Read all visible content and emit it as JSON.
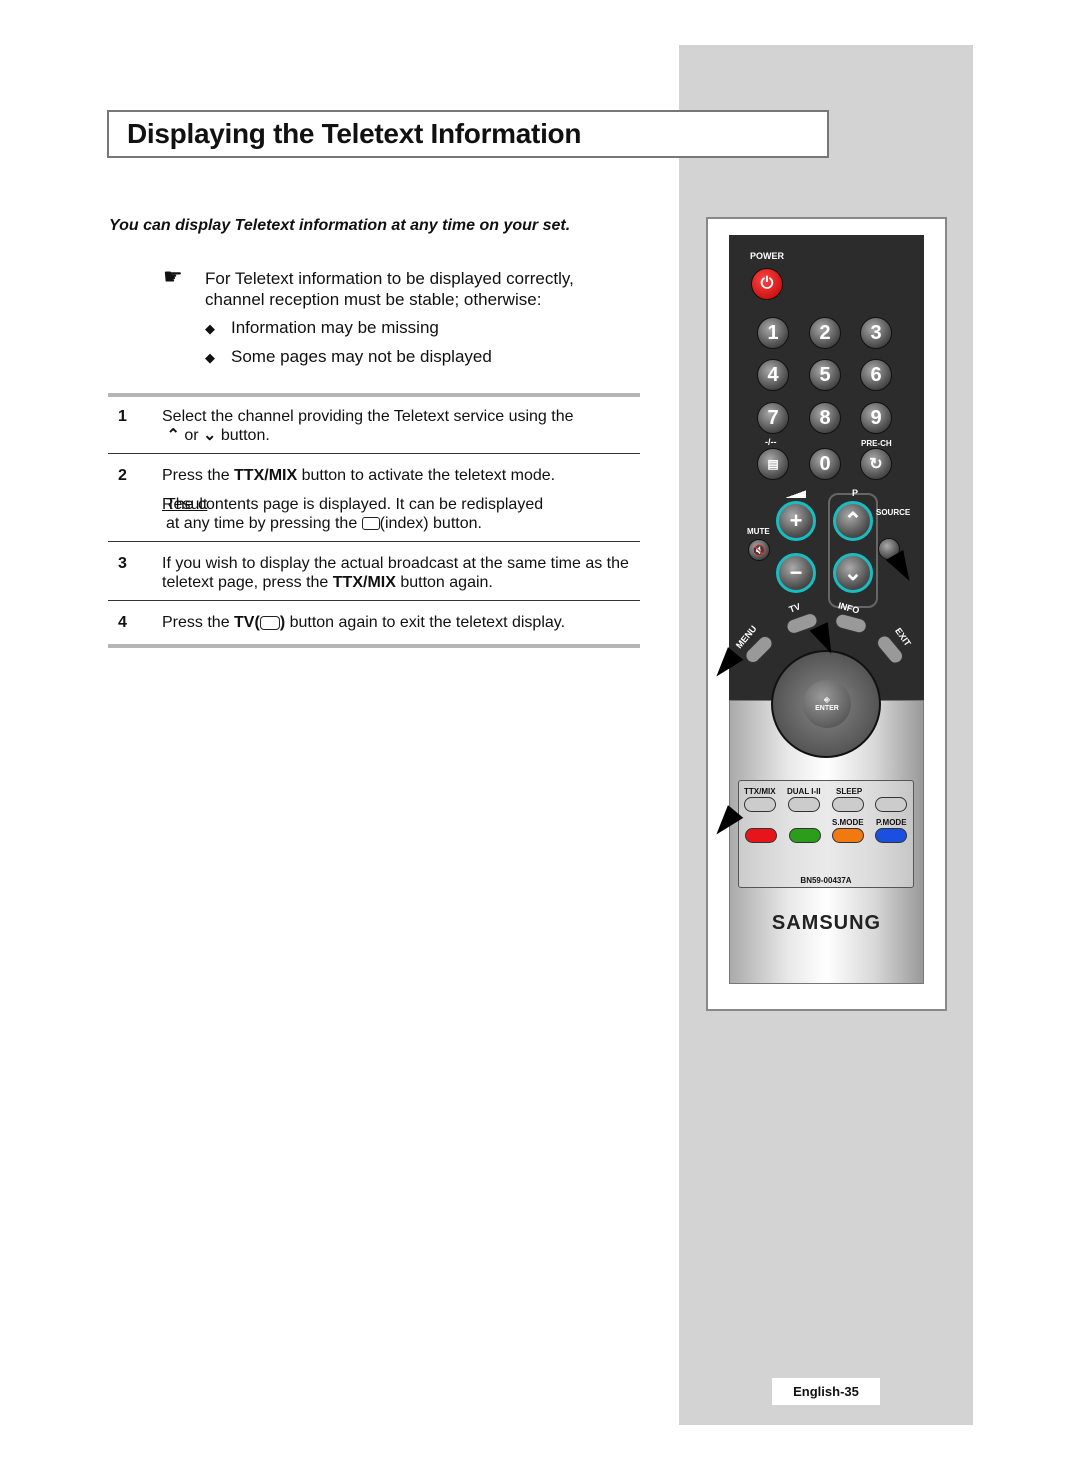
{
  "title": "Displaying the Teletext Information",
  "subtitle": "You can display Teletext information at any time on your set.",
  "note": {
    "icon": "pointing-hand-icon",
    "line1": "For Teletext information to be displayed correctly,",
    "line2": "channel reception must be stable; otherwise:",
    "bullets": [
      "Information may be missing",
      "Some pages may not be displayed"
    ],
    "bullet_symbol": "◆"
  },
  "steps": [
    {
      "num": "1",
      "text_a": "Select the channel providing the Teletext service using the",
      "up": "⌃",
      "or": "or",
      "down": "⌄",
      "text_b": "button."
    },
    {
      "num": "2",
      "pre": "Press the ",
      "bold": "TTX/MIX",
      "post": " button to activate the teletext mode.",
      "result_label": "Result",
      "result_colon": ":",
      "result_a": "The contents page is displayed. It can be redisplayed",
      "result_b": "at any time by pressing the",
      "result_c": "(index) button."
    },
    {
      "num": "3",
      "line1": "If you wish to display the actual broadcast at the same time as the",
      "pre": "teletext page, press the ",
      "bold": "TTX/MIX",
      "post": " button again."
    },
    {
      "num": "4",
      "pre": "Press the ",
      "bold": "TV(",
      "bold_close": ")",
      "post": "  button again to exit the teletext display."
    }
  ],
  "remote": {
    "power": "POWER",
    "digits": [
      "1",
      "2",
      "3",
      "4",
      "5",
      "6",
      "7",
      "8",
      "9",
      "0"
    ],
    "dash": "-/--",
    "prech": "PRE-CH",
    "mute": "MUTE",
    "p": "P",
    "source": "SOURCE",
    "tv": "TV",
    "info": "INFO",
    "menu": "MENU",
    "exit": "EXIT",
    "enter": "ENTER",
    "ttx": "TTX/MIX",
    "dual": "DUAL I-II",
    "sleep": "SLEEP",
    "smode": "S.MODE",
    "pmode": "P.MODE",
    "model": "BN59-00437A",
    "brand": "SAMSUNG",
    "colors": {
      "red": "#e8141c",
      "green": "#2a9e1a",
      "orange": "#f07a10",
      "blue": "#1a4fe0",
      "accent": "#1bbcc0"
    }
  },
  "page_label": "English-35"
}
